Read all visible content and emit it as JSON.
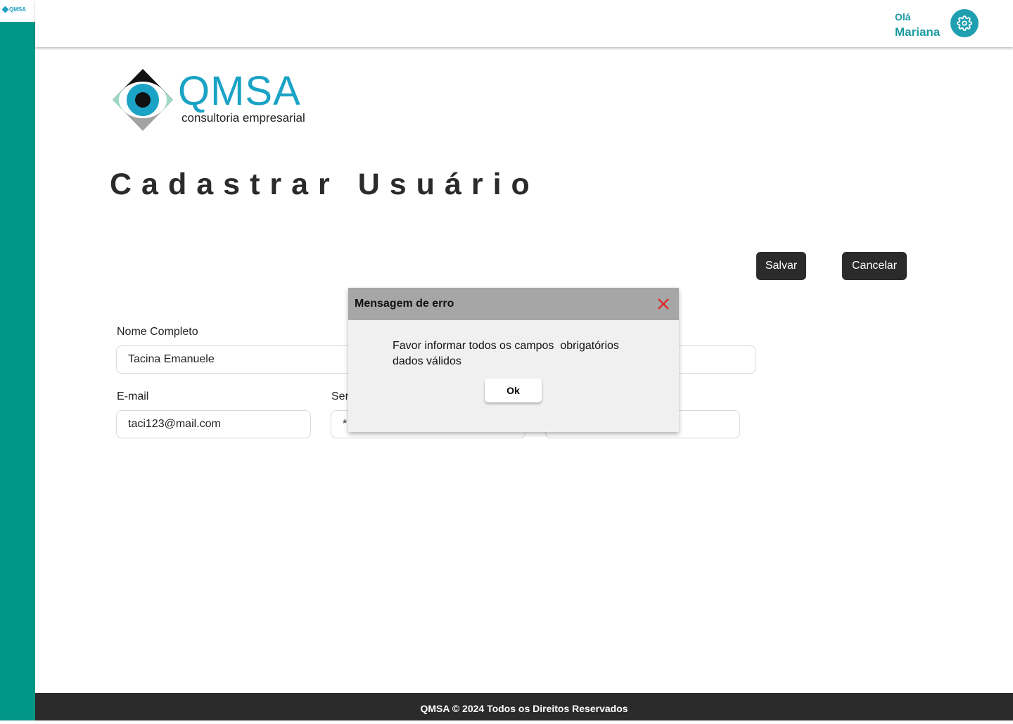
{
  "sidebar": {
    "logo_text": "QMSA"
  },
  "header": {
    "greeting": "Olá",
    "user_name": "Mariana",
    "settings_icon": "gear-icon"
  },
  "brand": {
    "name": "QMSA",
    "tagline": "consultoria empresarial"
  },
  "page": {
    "title": "Cadastrar Usuário"
  },
  "actions": {
    "save_label": "Salvar",
    "cancel_label": "Cancelar"
  },
  "form": {
    "full_name": {
      "label": "Nome Completo",
      "value": "Tacina Emanuele"
    },
    "email": {
      "label": "E-mail",
      "value": "taci123@mail.com"
    },
    "password": {
      "label": "Ser",
      "value": "*"
    }
  },
  "modal": {
    "title": "Mensagem de erro",
    "message_line1": "Favor informar todos os campos  obrigatórios",
    "message_line2": "dados válidos",
    "ok_label": "Ok",
    "close_color": "#e02020"
  },
  "footer": {
    "text": "QMSA © 2024 Todos os Direitos Reservados"
  },
  "colors": {
    "accent": "#009688",
    "dark": "#2b2b2b",
    "brand_blue": "#1ba3c6"
  }
}
